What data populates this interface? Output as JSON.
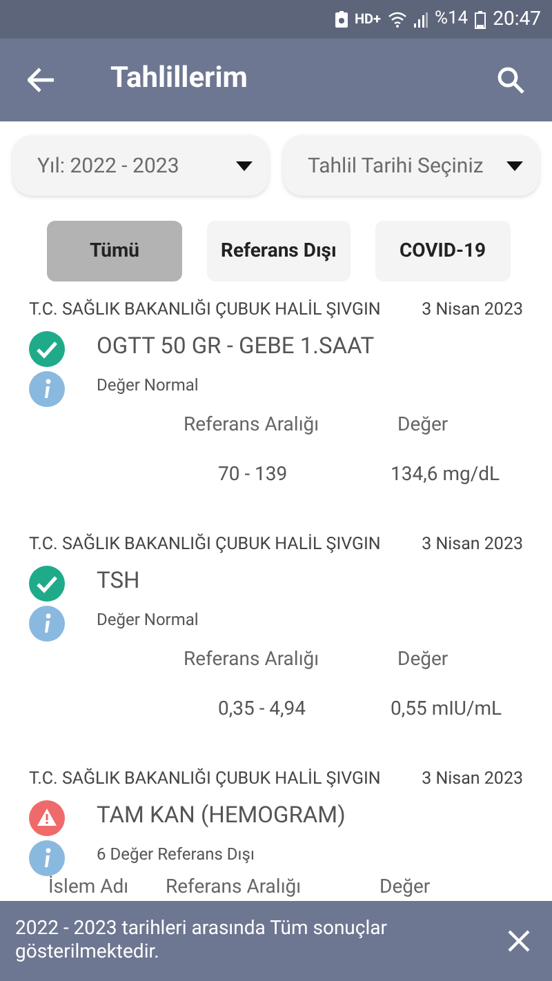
{
  "status_bar": {
    "network": "HD+",
    "battery": "%14",
    "time": "20:47"
  },
  "app_bar": {
    "title": "Tahlillerim"
  },
  "filters": [
    {
      "value": "Yıl: 2022 - 2023"
    },
    {
      "value": "Tahlil Tarihi Seçiniz"
    }
  ],
  "chips": [
    {
      "label": "Tümü",
      "selected": true
    },
    {
      "label": "Referans Dışı",
      "selected": false
    },
    {
      "label": "COVID-19",
      "selected": false
    }
  ],
  "results": [
    {
      "institution": "T.C. SAĞLIK BAKANLIĞI ÇUBUK HALİL ŞIVGIN",
      "date": "3 Nisan 2023",
      "test": "OGTT 50 GR - GEBE 1.SAAT",
      "kind": "normal",
      "note": "Değer Normal",
      "columns": [
        "Referans Aralığı",
        "Değer"
      ],
      "row": [
        "70 - 139",
        "134,6 mg/dL"
      ]
    },
    {
      "institution": "T.C. SAĞLIK BAKANLIĞI ÇUBUK HALİL ŞIVGIN",
      "date": "3 Nisan 2023",
      "test": "TSH",
      "kind": "normal",
      "note": "Değer Normal",
      "columns": [
        "Referans Aralığı",
        "Değer"
      ],
      "row": [
        "0,35 - 4,94",
        "0,55 mIU/mL"
      ]
    },
    {
      "institution": "T.C. SAĞLIK BAKANLIĞI ÇUBUK HALİL ŞIVGIN",
      "date": "3 Nisan 2023",
      "test": "TAM KAN (HEMOGRAM)",
      "kind": "abnormal",
      "note": "6 Değer Referans Dışı",
      "columns": [
        "İslem Adı",
        "Referans Aralığı",
        "Değer"
      ]
    }
  ],
  "snackbar": {
    "message": "2022 - 2023 tarihleri arasında Tüm sonuçlar gösterilmektedir."
  }
}
